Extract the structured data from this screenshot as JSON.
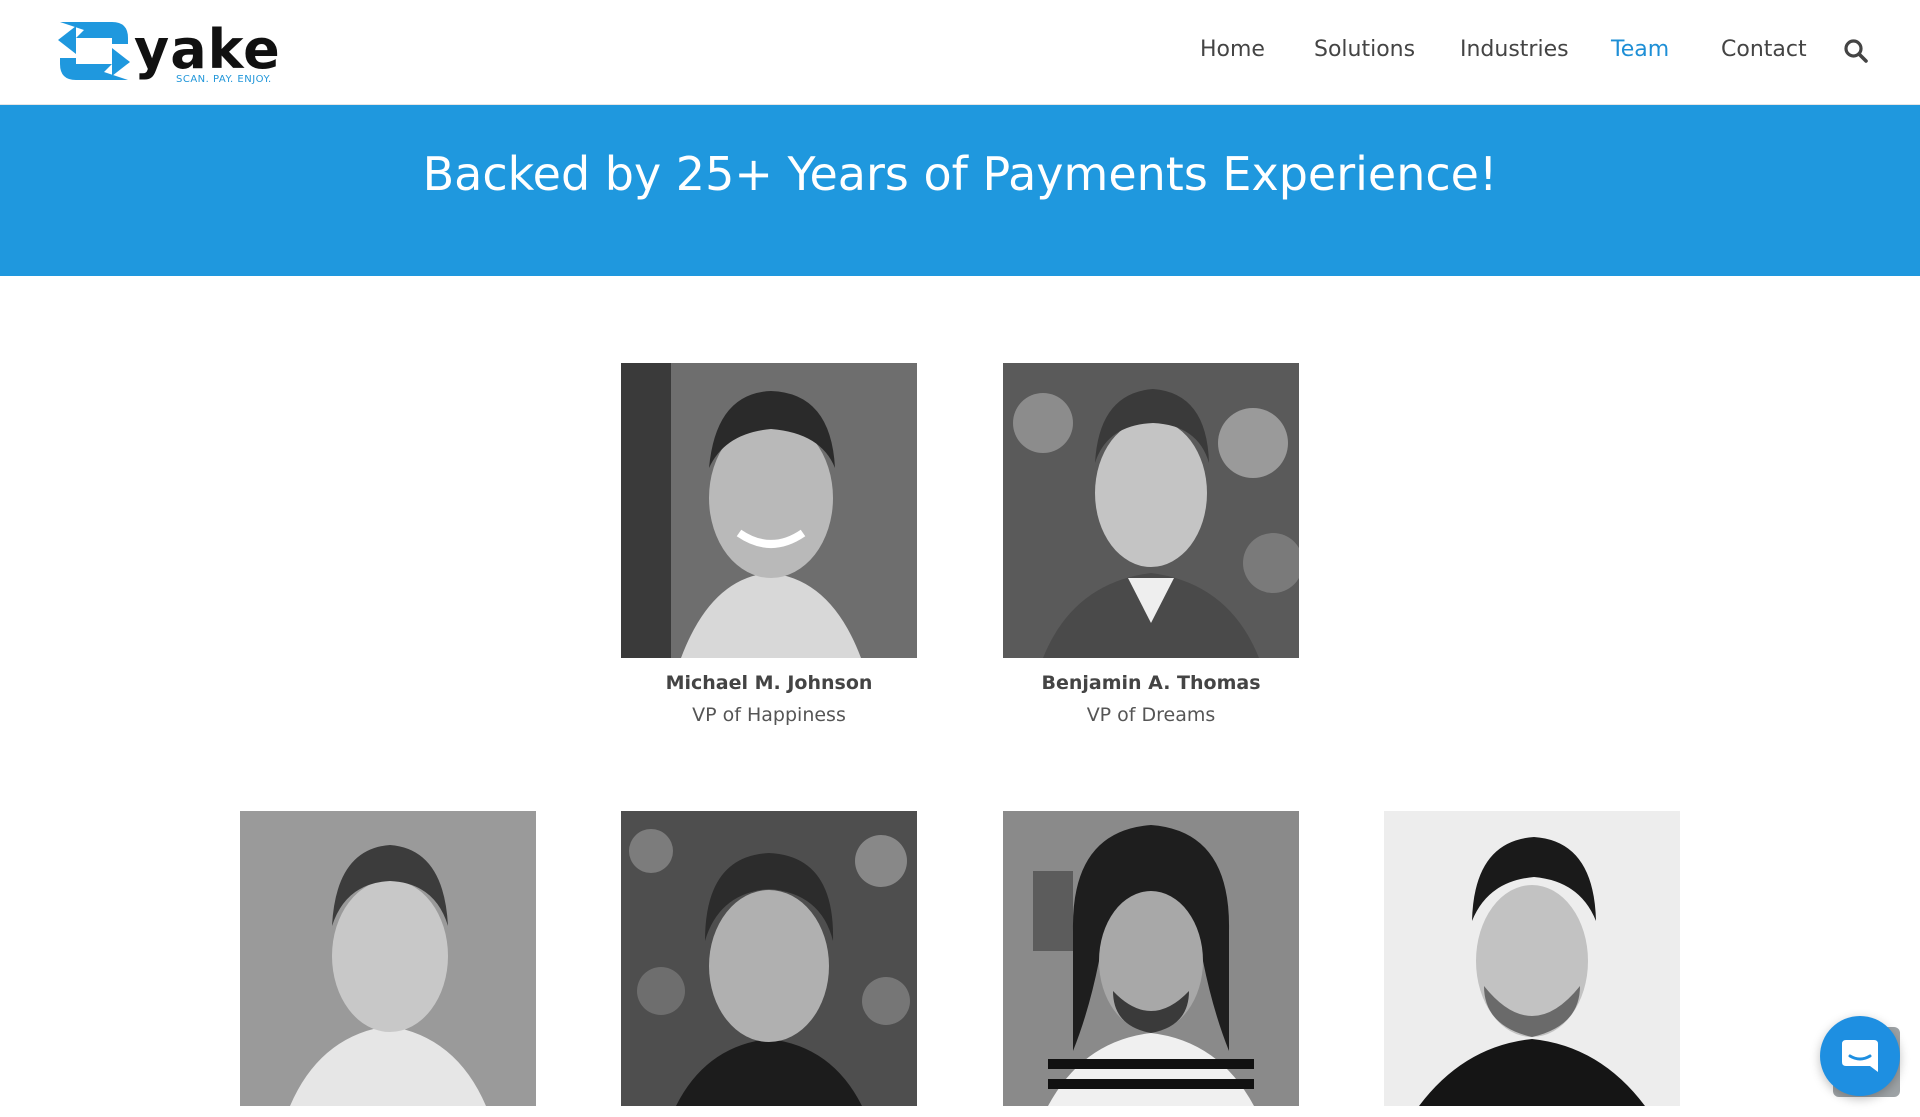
{
  "brand": {
    "name": "yake",
    "tagline": "SCAN. PAY. ENJOY.",
    "color": "#1e8fd6"
  },
  "nav": {
    "items": [
      {
        "label": "Home",
        "active": false
      },
      {
        "label": "Solutions",
        "active": false
      },
      {
        "label": "Industries",
        "active": false
      },
      {
        "label": "Team",
        "active": true
      },
      {
        "label": "Contact",
        "active": false
      }
    ],
    "search_icon": "search-icon"
  },
  "banner": {
    "title": "Backed by 25+ Years of Payments Experience!",
    "background": "#1f98de"
  },
  "team": [
    {
      "name": "Michael M. Johnson",
      "role": "VP of Happiness"
    },
    {
      "name": "Benjamin A. Thomas",
      "role": "VP of Dreams"
    },
    {
      "name": "",
      "role": ""
    },
    {
      "name": "",
      "role": ""
    },
    {
      "name": "",
      "role": ""
    },
    {
      "name": "",
      "role": ""
    }
  ],
  "chat": {
    "icon": "chat-bubble-icon",
    "color": "#1e8fe1"
  }
}
